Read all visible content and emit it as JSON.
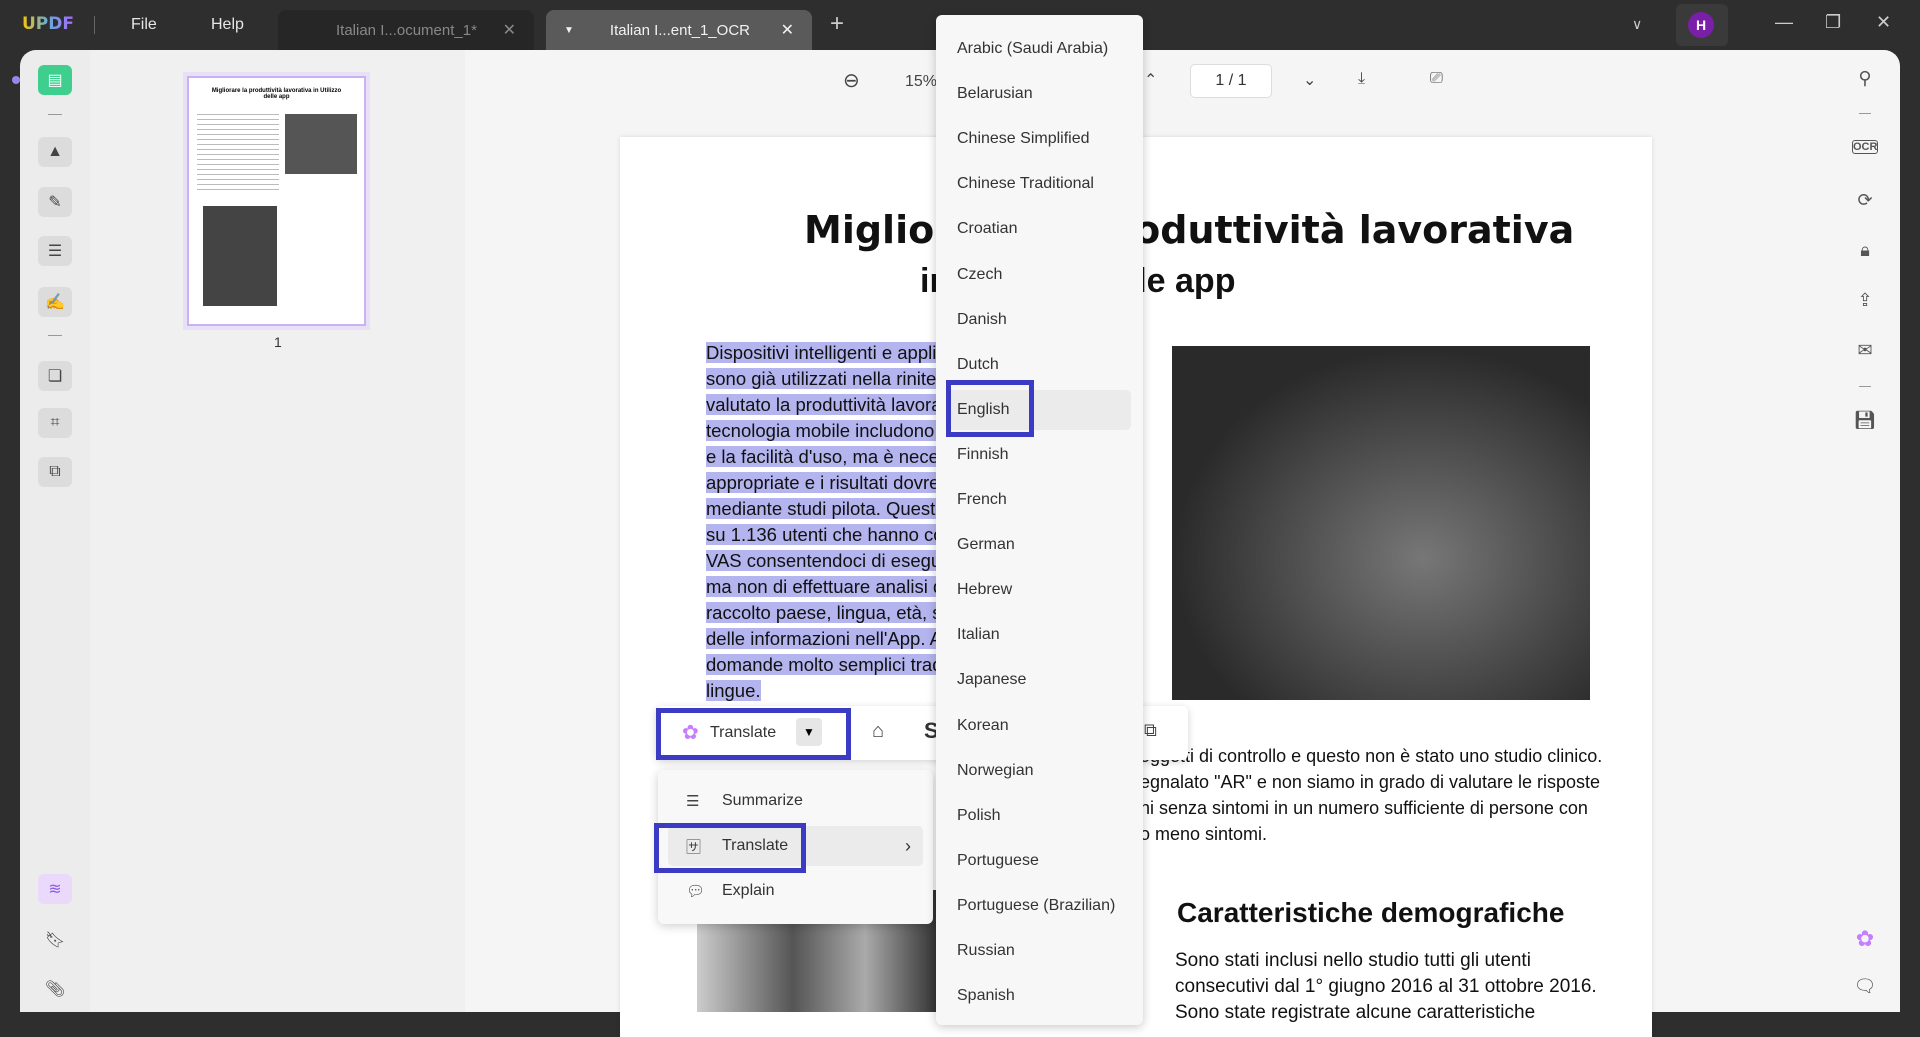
{
  "app": {
    "logo": "UPDF",
    "menu": [
      "File",
      "Help"
    ],
    "avatar": "H"
  },
  "tabs": [
    {
      "label": "Italian I...ocument_1*",
      "close": "✕"
    },
    {
      "label": "Italian I...ent_1_OCR",
      "close": "✕"
    }
  ],
  "toolbar": {
    "zoom": "15%",
    "page": "1 / 1"
  },
  "thumbnail": {
    "page_label": "1",
    "title": "Migliorare la produttività lavorativa in Utilizzo delle app"
  },
  "document": {
    "title_line1": "Migliorare la produttività lavorativa",
    "title_line2": "in Utilizzo delle app",
    "paragraph_lines": [
      "Dispositivi intelligenti e applic",
      "sono già utilizzati nella rinite (",
      "valutato la produttività lavorat",
      "tecnologia mobile includono la",
      "e la facilità d'uso, ma è neces",
      "appropriate e i risultati dovreb",
      "mediante studi pilota. Questo",
      "su 1.136 utenti che hanno co",
      "VAS consentendoci di eseguir",
      "ma non di effettuare analisi d",
      "raccolto paese, lingua, età, se",
      "delle informazioni nell'App. A",
      "domande molto semplici trad",
      "lingue."
    ],
    "right_lines": [
      "oggetti di controllo e questo non è stato uno studio clinico.",
      "egnalato \"AR\" e non siamo in grado di valutare le risposte",
      "ni senza sintomi in un numero sufficiente di persone con",
      "o meno sintomi."
    ],
    "heading2": "Caratteristiche demografiche",
    "para2_lines": [
      "Sono stati inclusi nello studio tutti gli utenti",
      "consecutivi dal 1° giugno 2016 al 31 ottobre 2016.",
      "Sono state registrate alcune caratteristiche"
    ]
  },
  "floatbar": {
    "translate_label": "Translate"
  },
  "context_menu": [
    {
      "label": "Summarize",
      "icon": "list-icon"
    },
    {
      "label": "Translate",
      "icon": "translate-icon"
    },
    {
      "label": "Explain",
      "icon": "explain-icon"
    }
  ],
  "languages": [
    "Arabic (Saudi Arabia)",
    "Belarusian",
    "Chinese Simplified",
    "Chinese Traditional",
    "Croatian",
    "Czech",
    "Danish",
    "Dutch",
    "English",
    "Finnish",
    "French",
    "German",
    "Hebrew",
    "Italian",
    "Japanese",
    "Korean",
    "Norwegian",
    "Polish",
    "Portuguese",
    "Portuguese (Brazilian)",
    "Russian",
    "Spanish"
  ],
  "selected_language": "English",
  "colors": {
    "highlight": "#b4b4ee",
    "callout": "#3b3bc4",
    "accent": "#7a1fa8"
  }
}
